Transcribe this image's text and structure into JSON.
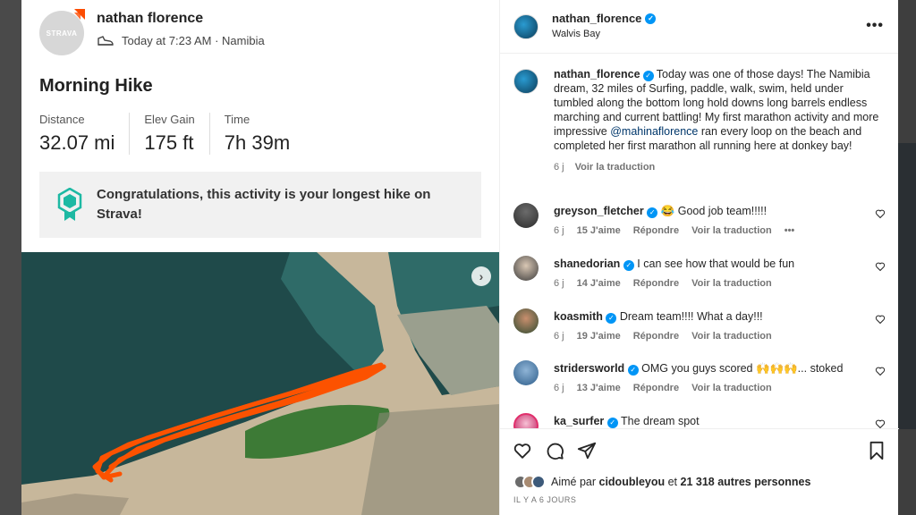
{
  "strava": {
    "athlete_name": "nathan florence",
    "avatar_label": "STRAVA",
    "datetime_location": "Today at 7:23 AM · Namibia",
    "activity_title": "Morning Hike",
    "stats": [
      {
        "label": "Distance",
        "value": "32.07 mi"
      },
      {
        "label": "Elev Gain",
        "value": "175 ft"
      },
      {
        "label": "Time",
        "value": "7h 39m"
      }
    ],
    "congrats": "Congratulations, this activity is your longest hike on Strava!",
    "colors": {
      "route": "#fc5200",
      "brand": "#fc4c02"
    }
  },
  "post": {
    "header": {
      "username": "nathan_florence",
      "location": "Walvis Bay",
      "more_label": "•••"
    },
    "caption": {
      "username": "nathan_florence",
      "text_before": " Today was one of those days! The Namibia dream, 32 miles of Surfing, paddle, walk, swim, held under tumbled along the bottom long hold downs long barrels endless marching and current battling! My first marathon activity and more impressive ",
      "mention": "@mahinaflorence",
      "text_after": " ran every loop on the beach and completed her first marathon all running here at donkey bay!",
      "age": "6 j",
      "translate": "Voir la traduction"
    },
    "comments": [
      {
        "username": "greyson_fletcher",
        "verified": true,
        "text": "😂 Good job team!!!!!",
        "age": "6 j",
        "likes": "15 J'aime",
        "reply": "Répondre",
        "translate": "Voir la traduction",
        "more": "•••"
      },
      {
        "username": "shanedorian",
        "verified": true,
        "text": "I can see how that would be fun",
        "age": "6 j",
        "likes": "14 J'aime",
        "reply": "Répondre",
        "translate": "Voir la traduction",
        "more": ""
      },
      {
        "username": "koasmith",
        "verified": true,
        "text": "Dream team!!!! What a day!!!",
        "age": "6 j",
        "likes": "19 J'aime",
        "reply": "Répondre",
        "translate": "Voir la traduction",
        "more": ""
      },
      {
        "username": "stridersworld",
        "verified": true,
        "text": "OMG you guys scored 🙌🙌🙌... stoked",
        "age": "6 j",
        "likes": "13 J'aime",
        "reply": "Répondre",
        "translate": "Voir la traduction",
        "more": ""
      },
      {
        "username": "ka_surfer",
        "verified": true,
        "text": "The dream spot",
        "age": "",
        "likes": "",
        "reply": "",
        "translate": "",
        "more": ""
      }
    ],
    "liked_by_prefix": "Aimé par ",
    "liked_by_user": "cidoubleyou",
    "liked_by_mid": " et ",
    "liked_by_count": "21 318 autres personnes",
    "timestamp": "IL Y A 6 JOURS"
  }
}
